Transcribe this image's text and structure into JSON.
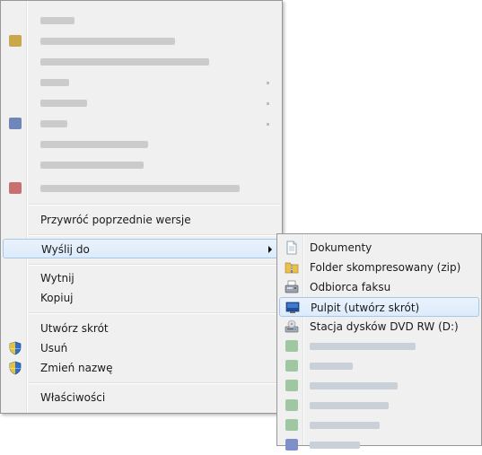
{
  "context_menu": {
    "items": [
      {
        "label": "Przywróć poprzednie wersje"
      },
      {
        "label": "Wyślij do"
      },
      {
        "label": "Wytnij"
      },
      {
        "label": "Kopiuj"
      },
      {
        "label": "Utwórz skrót"
      },
      {
        "label": "Usuń"
      },
      {
        "label": "Zmień nazwę"
      },
      {
        "label": "Właściwości"
      }
    ]
  },
  "send_to_menu": {
    "items": [
      {
        "label": "Dokumenty",
        "icon": "document-icon"
      },
      {
        "label": "Folder skompresowany (zip)",
        "icon": "zip-folder-icon"
      },
      {
        "label": "Odbiorca faksu",
        "icon": "fax-icon"
      },
      {
        "label": "Pulpit (utwórz skrót)",
        "icon": "desktop-icon"
      },
      {
        "label": "Stacja dysków DVD RW (D:)",
        "icon": "dvd-drive-icon"
      }
    ]
  },
  "colors": {
    "highlight_border": "#a8c8ea",
    "highlight_fill": "#dcebfc",
    "menu_background": "#f0f0f0"
  }
}
